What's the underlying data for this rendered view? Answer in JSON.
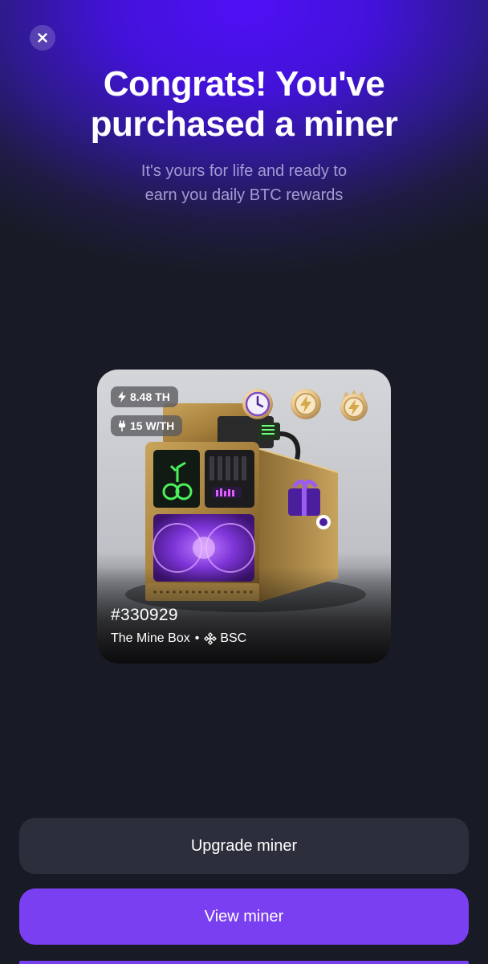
{
  "header": {
    "title_line1": "Congrats! You've",
    "title_line2": "purchased a miner",
    "subtitle_line1": "It's yours for life and ready to",
    "subtitle_line2": "earn you daily BTC rewards"
  },
  "close_icon": "close-icon",
  "miner_card": {
    "hashrate": "8.48 TH",
    "hashrate_icon": "bolt-icon",
    "efficiency": "15 W/TH",
    "efficiency_icon": "plug-icon",
    "badges": [
      "clock-badge-icon",
      "lightning-badge-icon",
      "lightning-crown-badge-icon"
    ],
    "id": "#330929",
    "name": "The Mine Box",
    "separator": "•",
    "network": "BSC",
    "network_icon": "bnb-chain-icon"
  },
  "actions": {
    "upgrade_label": "Upgrade miner",
    "view_label": "View miner"
  },
  "colors": {
    "background": "#181b26",
    "header_glow": "#5010f6",
    "primary_button": "#7a3ff0",
    "secondary_button": "#2d2e3b",
    "subtitle": "#a59ad4"
  }
}
